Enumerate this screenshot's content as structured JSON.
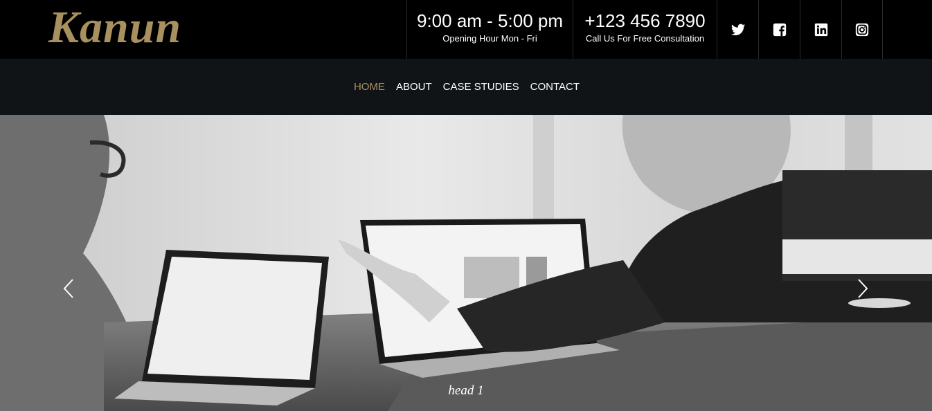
{
  "brand": {
    "logo_text": "Kanun",
    "accent_color": "#a9915f"
  },
  "header": {
    "hours": {
      "main": "9:00 am - 5:00 pm",
      "sub": "Opening Hour Mon - Fri"
    },
    "phone": {
      "main": "+123 456 7890",
      "sub": "Call Us For Free Consultation"
    },
    "social": [
      {
        "name": "twitter",
        "icon": "twitter-icon"
      },
      {
        "name": "facebook",
        "icon": "facebook-icon"
      },
      {
        "name": "linkedin",
        "icon": "linkedin-icon"
      },
      {
        "name": "instagram",
        "icon": "instagram-icon"
      }
    ]
  },
  "nav": {
    "items": [
      {
        "label": "HOME",
        "active": true
      },
      {
        "label": "ABOUT",
        "active": false
      },
      {
        "label": "CASE STUDIES",
        "active": false
      },
      {
        "label": "CONTACT",
        "active": false
      }
    ]
  },
  "hero": {
    "slide_title": "head 1",
    "prev_icon": "chevron-left-icon",
    "next_icon": "chevron-right-icon"
  }
}
